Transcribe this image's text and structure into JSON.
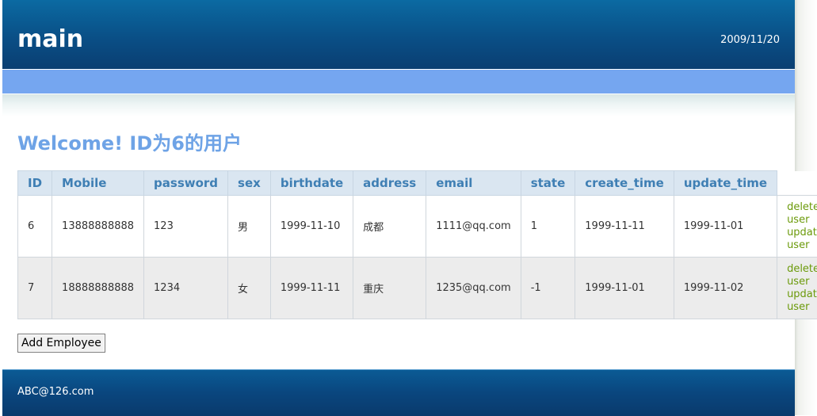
{
  "header": {
    "title": "main",
    "date": "2009/11/20"
  },
  "welcome": "Welcome! ID为6的用户",
  "table": {
    "columns": [
      "ID",
      "Mobile",
      "password",
      "sex",
      "birthdate",
      "address",
      "email",
      "state",
      "create_time",
      "update_time"
    ],
    "rows": [
      {
        "id": "6",
        "mobile": "13888888888",
        "password": "123",
        "sex": "男",
        "birthdate": "1999-11-10",
        "address": "成都",
        "email": "1111@qq.com",
        "state": "1",
        "create_time": "1999-11-11",
        "update_time": "1999-11-01"
      },
      {
        "id": "7",
        "mobile": "18888888888",
        "password": "1234",
        "sex": "女",
        "birthdate": "1999-11-11",
        "address": "重庆",
        "email": "1235@qq.com",
        "state": "-1",
        "create_time": "1999-11-01",
        "update_time": "1999-11-02"
      }
    ],
    "actions": {
      "delete_label": "delete user",
      "update_label": "update user"
    }
  },
  "add_button": "Add Employee",
  "footer": {
    "text": "ABC@126.com"
  },
  "colors": {
    "header_bg": "#0a4f86",
    "nav_bg": "#75a6f0",
    "welcome": "#6ea3e6",
    "table_header_bg": "#dae6f1",
    "table_header_text": "#3f7fb4",
    "action_link": "#6b9a0a",
    "alt_row_bg": "#ececec"
  }
}
